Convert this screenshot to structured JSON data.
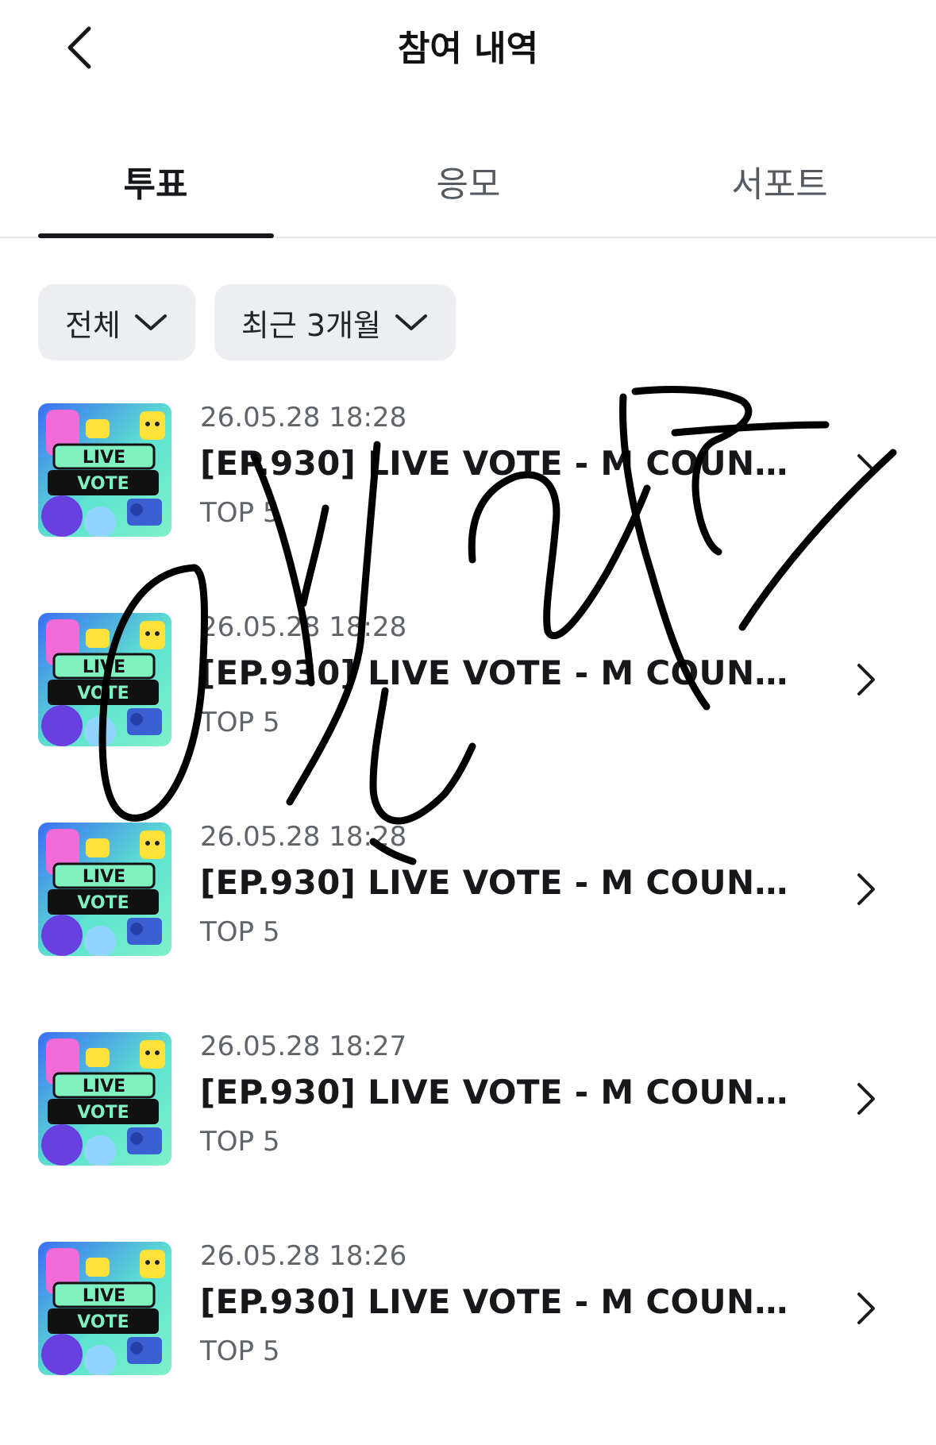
{
  "header": {
    "title": "참여 내역",
    "back_icon": "chevron-left-icon"
  },
  "tabs": [
    {
      "label": "투표",
      "active": true
    },
    {
      "label": "응모",
      "active": false
    },
    {
      "label": "서포트",
      "active": false
    }
  ],
  "filters": {
    "type": {
      "label": "전체",
      "icon": "chevron-down-icon"
    },
    "period": {
      "label": "최근 3개월",
      "icon": "chevron-down-icon"
    }
  },
  "items": [
    {
      "date": "26.05.28 18:28",
      "title": "[EP.930] LIVE VOTE - M COUNT...",
      "subtitle": "TOP 5",
      "thumb": {
        "line1": "LIVE",
        "line2": "VOTE"
      }
    },
    {
      "date": "26.05.28 18:28",
      "title": "[EP.930] LIVE VOTE - M COUNT...",
      "subtitle": "TOP 5",
      "thumb": {
        "line1": "LIVE",
        "line2": "VOTE"
      }
    },
    {
      "date": "26.05.28 18:28",
      "title": "[EP.930] LIVE VOTE - M COUNT...",
      "subtitle": "TOP 5",
      "thumb": {
        "line1": "LIVE",
        "line2": "VOTE"
      }
    },
    {
      "date": "26.05.28 18:27",
      "title": "[EP.930] LIVE VOTE - M COUNT...",
      "subtitle": "TOP 5",
      "thumb": {
        "line1": "LIVE",
        "line2": "VOTE"
      }
    },
    {
      "date": "26.05.28 18:26",
      "title": "[EP.930] LIVE VOTE - M COUNT...",
      "subtitle": "TOP 5",
      "thumb": {
        "line1": "LIVE",
        "line2": "VOTE"
      }
    }
  ],
  "colors": {
    "accent_text": "#16181b",
    "secondary_text": "#60646b",
    "chip_bg": "#eceef1",
    "thumb_teal": "#5ee3d0",
    "thumb_blue": "#3a6ff2",
    "thumb_yellow": "#ffe23a",
    "thumb_pink": "#f06bd8"
  }
}
